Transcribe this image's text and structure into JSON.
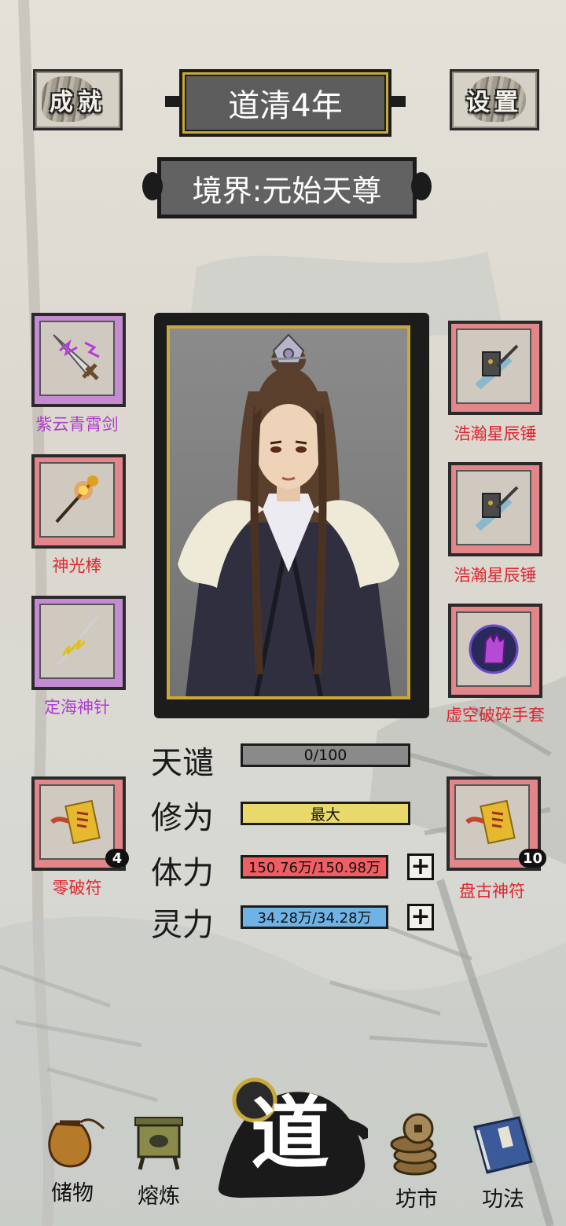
{
  "top_bar": {
    "achievements_label": "成就",
    "settings_label": "设置",
    "year": "道清4年"
  },
  "realm": "境界:元始天尊",
  "equipment": {
    "left": [
      {
        "name": "紫云青霄剑",
        "rarity": "purple",
        "icon": "sword-icon"
      },
      {
        "name": "神光棒",
        "rarity": "red",
        "icon": "staff-icon"
      },
      {
        "name": "定海神针",
        "rarity": "purple",
        "icon": "needle-icon"
      }
    ],
    "right": [
      {
        "name": "浩瀚星辰锤",
        "rarity": "red",
        "icon": "hammer-icon"
      },
      {
        "name": "浩瀚星辰锤",
        "rarity": "red",
        "icon": "hammer-icon"
      },
      {
        "name": "虚空破碎手套",
        "rarity": "red",
        "icon": "gauntlet-icon"
      }
    ]
  },
  "talismans": {
    "left": {
      "name": "零破符",
      "count": "4",
      "icon": "talisman-icon"
    },
    "right": {
      "name": "盘古神符",
      "count": "10",
      "icon": "talisman-icon"
    }
  },
  "stats": {
    "tribulation": {
      "label": "天谴",
      "value": "0/100",
      "fill": 0
    },
    "cultivation": {
      "label": "修为",
      "value": "最大",
      "fill": 1
    },
    "health": {
      "label": "体力",
      "value": "150.76万/150.98万",
      "fill": 0.998
    },
    "spirit": {
      "label": "灵力",
      "value": "34.28万/34.28万",
      "fill": 1
    },
    "plus": "+"
  },
  "nav": {
    "storage": "储物",
    "smelting": "熔炼",
    "dao": "道",
    "market": "坊市",
    "techniques": "功法"
  },
  "colors": {
    "purple_rarity": "#c48bd2",
    "red_rarity": "#e2868a",
    "purple_text": "#b03bd0",
    "red_text": "#e2242e",
    "cultivation_bar": "#e9d96b",
    "health_bar": "#ee5e63",
    "spirit_bar": "#6fb3e6",
    "tribulation_bar": "#8a8a8a",
    "gold_trim": "#c9a93a"
  }
}
